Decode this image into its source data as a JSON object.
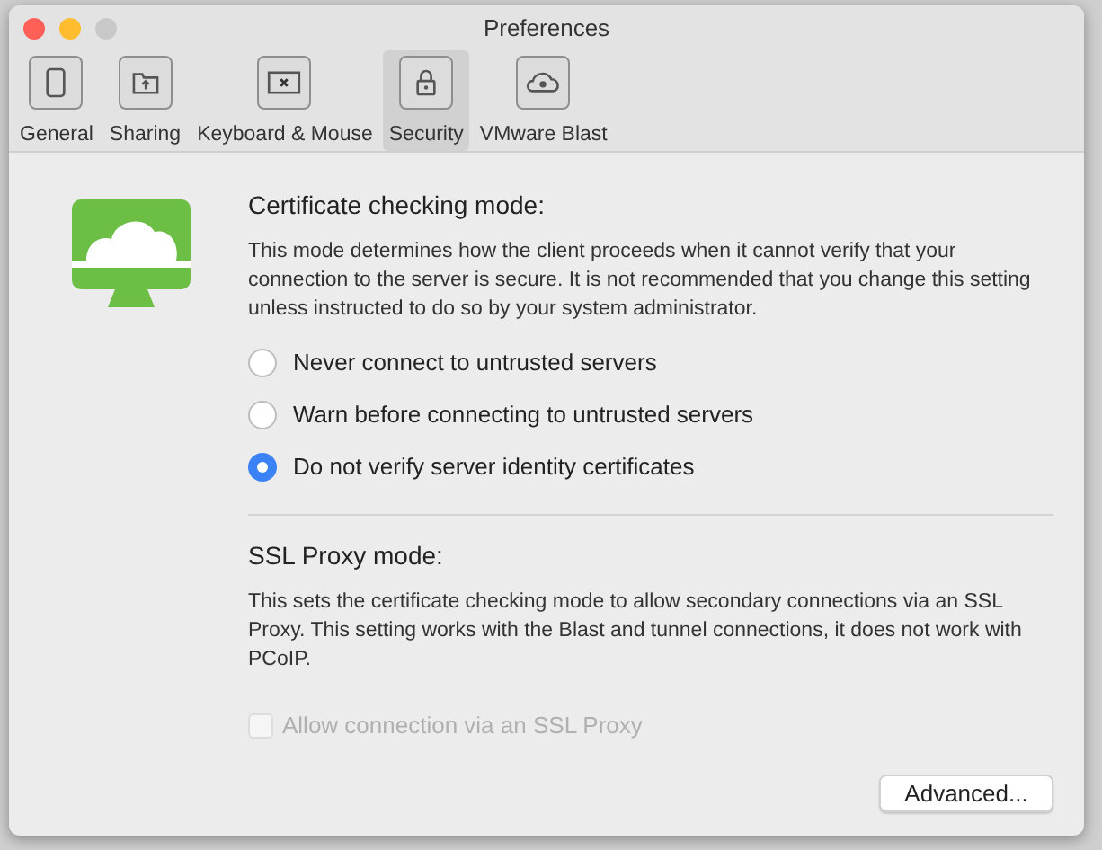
{
  "window": {
    "title": "Preferences"
  },
  "tabs": [
    {
      "label": "General",
      "selected": false
    },
    {
      "label": "Sharing",
      "selected": false
    },
    {
      "label": "Keyboard & Mouse",
      "selected": false
    },
    {
      "label": "Security",
      "selected": true
    },
    {
      "label": "VMware Blast",
      "selected": false
    }
  ],
  "certificate_mode": {
    "heading": "Certificate checking mode:",
    "description": "This mode determines how the client proceeds when it cannot verify that your connection to the server is secure. It is not recommended that you change this setting unless instructed to do so by your system administrator.",
    "options": [
      {
        "label": "Never connect to untrusted servers",
        "selected": false
      },
      {
        "label": "Warn before connecting to untrusted servers",
        "selected": false
      },
      {
        "label": "Do not verify server identity certificates",
        "selected": true
      }
    ]
  },
  "ssl_proxy_mode": {
    "heading": "SSL Proxy mode:",
    "description": "This sets the certificate checking mode to allow secondary connections via an SSL Proxy. This setting works with the Blast and tunnel connections, it does not work with PCoIP.",
    "checkbox": {
      "label": "Allow connection via an SSL Proxy",
      "checked": false,
      "disabled": true
    }
  },
  "advanced_button": "Advanced..."
}
